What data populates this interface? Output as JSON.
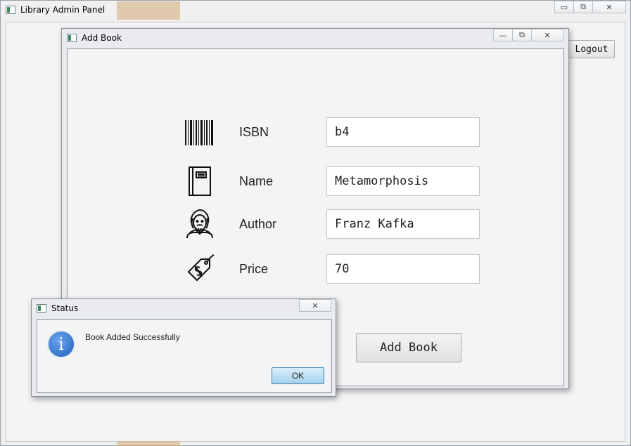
{
  "main_window": {
    "title": "Library Admin Panel",
    "controls": {
      "minimize": "▭",
      "maximize": "⧉",
      "close": "✕"
    },
    "logout_label": "Logout"
  },
  "add_book_dialog": {
    "title": "Add Book",
    "controls": {
      "minimize": "—",
      "maximize": "⧉",
      "close": "✕"
    },
    "fields": {
      "isbn": {
        "label": "ISBN",
        "value": "b4",
        "icon": "barcode-icon"
      },
      "name": {
        "label": "Name",
        "value": "Metamorphosis",
        "icon": "book-icon"
      },
      "author": {
        "label": "Author",
        "value": "Franz Kafka",
        "icon": "author-icon"
      },
      "price": {
        "label": "Price",
        "value": "70",
        "icon": "price-tag-icon"
      }
    },
    "submit_label": "Add Book"
  },
  "status_dialog": {
    "title": "Status",
    "close": "✕",
    "icon": "info-icon",
    "info_glyph": "i",
    "message": "Book Added Successfully",
    "ok_label": "OK"
  }
}
